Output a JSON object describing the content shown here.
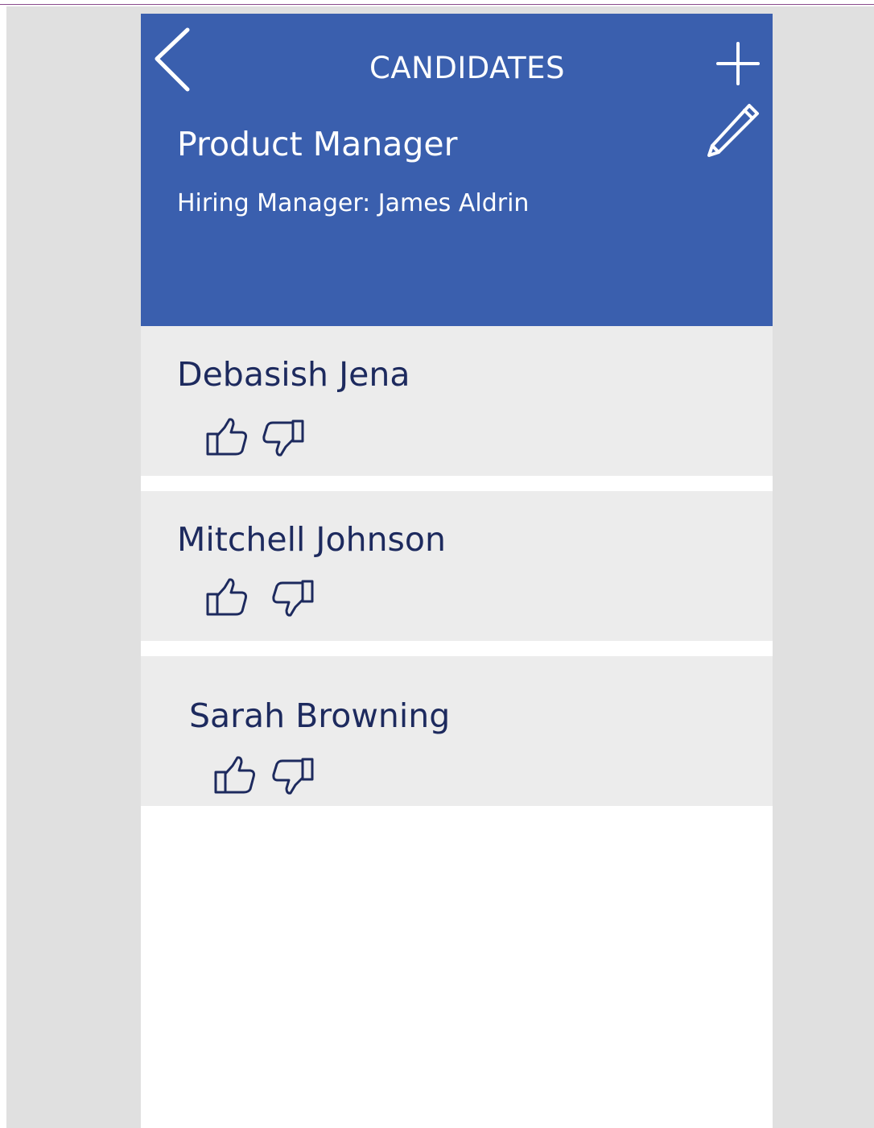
{
  "header": {
    "title": "CANDIDATES",
    "job_title": "Product Manager",
    "hiring_manager": "Hiring Manager: James Aldrin",
    "background_color": "#3a5fae",
    "icons": {
      "back": "chevron-left-icon",
      "add": "plus-icon",
      "edit": "pencil-icon"
    }
  },
  "candidates": [
    {
      "name": "Debasish Jena"
    },
    {
      "name": "Mitchell Johnson"
    },
    {
      "name": "Sarah Browning"
    }
  ],
  "colors": {
    "canvas": "#e0e0e0",
    "row_background": "#ececec",
    "row_text": "#1d2a5e",
    "icon_stroke": "#1d2a5e"
  }
}
